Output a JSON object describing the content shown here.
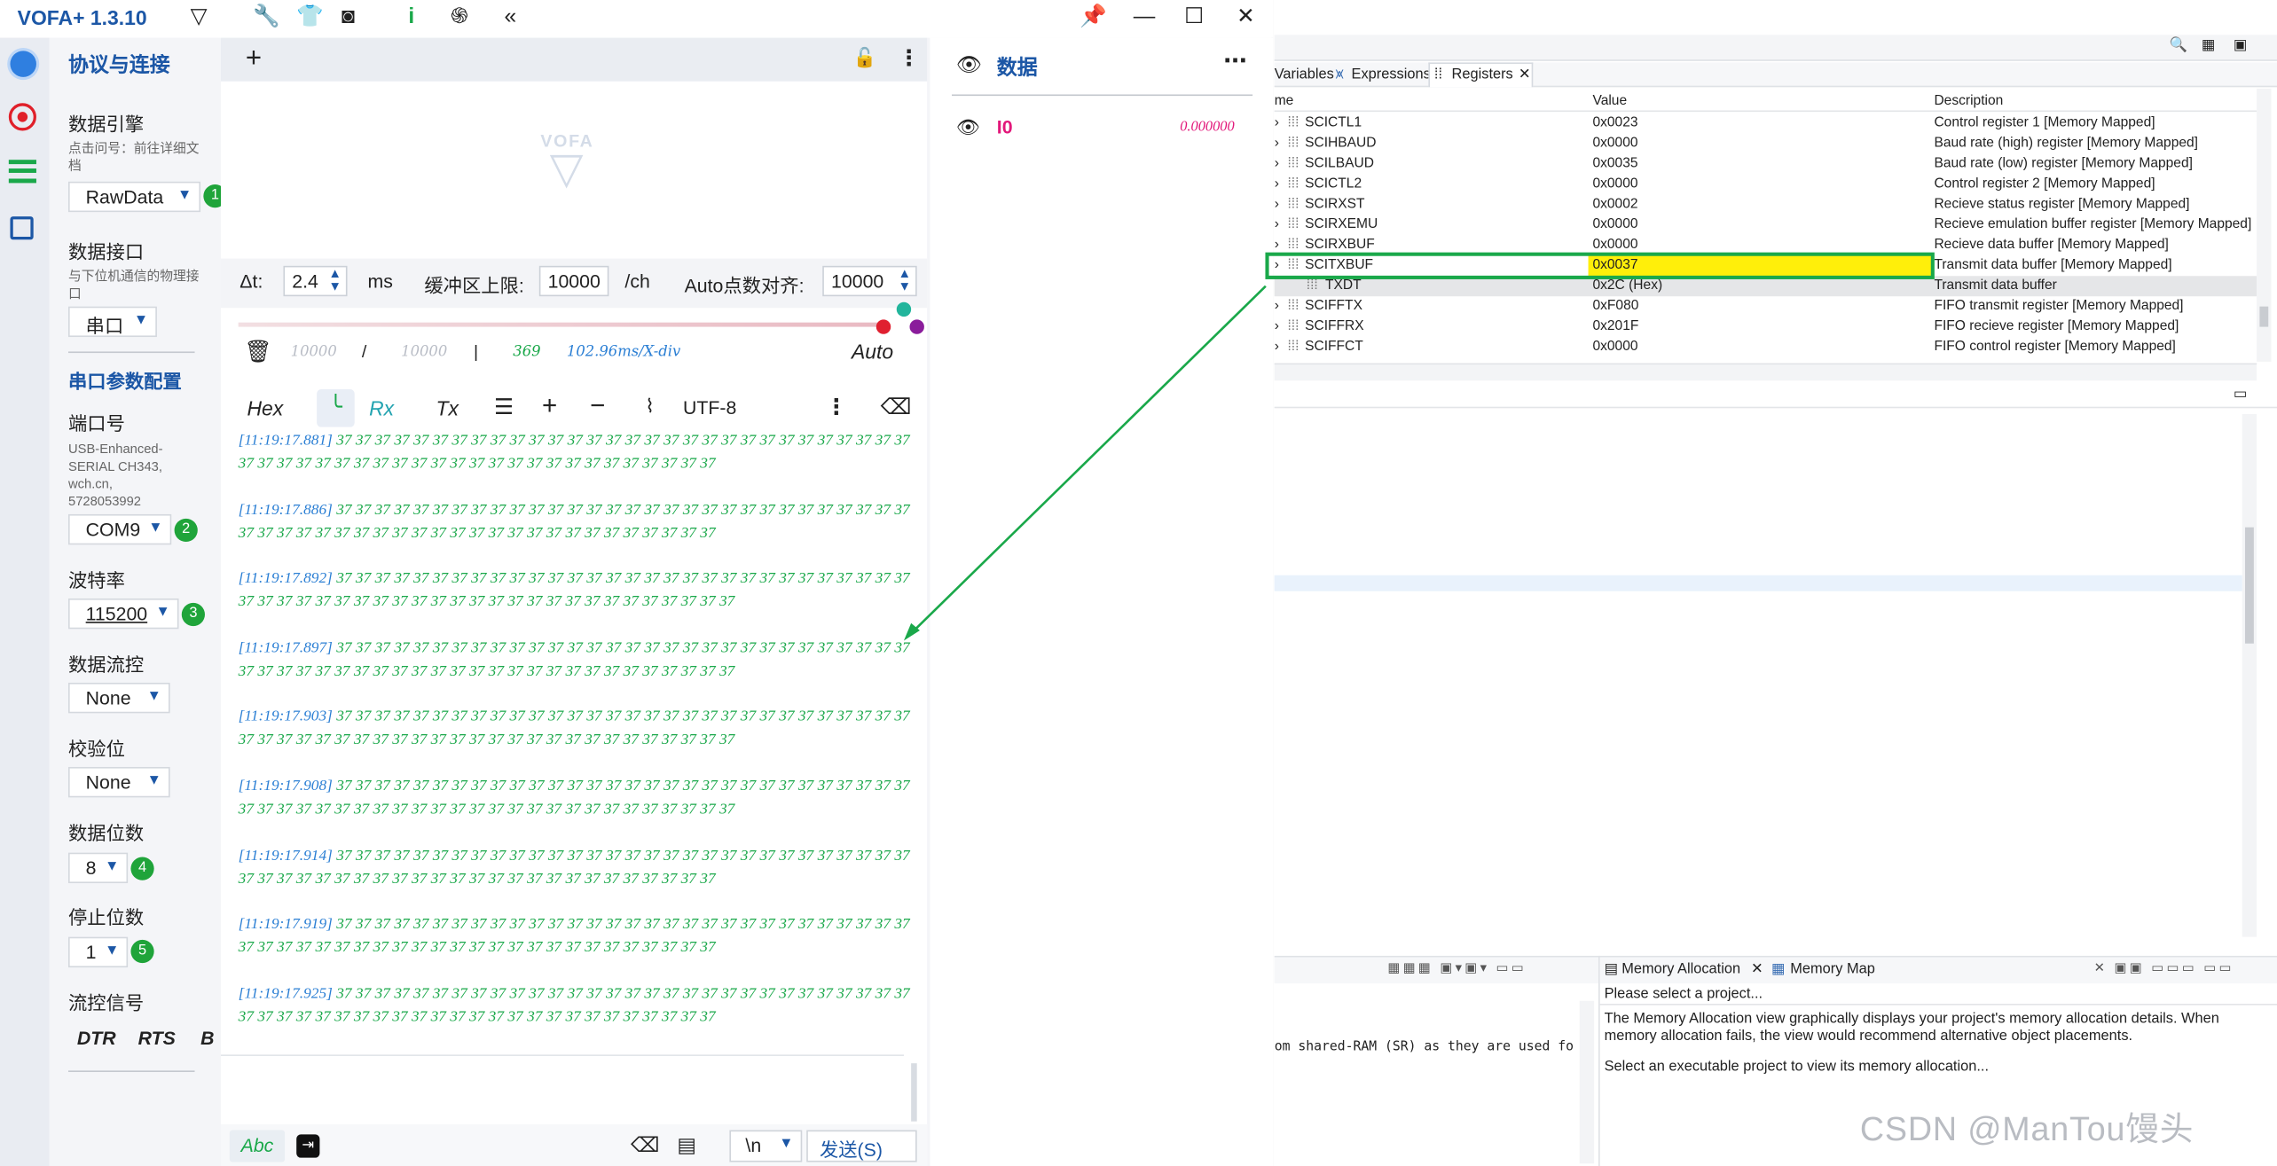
{
  "app": {
    "title": "VOFA+ 1.3.10"
  },
  "config": {
    "section_title": "协议与连接",
    "engine": {
      "label": "数据引擎",
      "hint": "点击问号：前往详细文档",
      "value": "RawData",
      "badge": "1"
    },
    "interface": {
      "label": "数据接口",
      "hint": "与下位机通信的物理接口",
      "value": "串口"
    },
    "serial_title": "串口参数配置",
    "port": {
      "label": "端口号",
      "hint": "USB-Enhanced-SERIAL CH343, wch.cn, 5728053992",
      "value": "COM9",
      "badge": "2"
    },
    "baud": {
      "label": "波特率",
      "value": "115200",
      "badge": "3"
    },
    "flow": {
      "label": "数据流控",
      "value": "None"
    },
    "parity": {
      "label": "校验位",
      "value": "None"
    },
    "databits": {
      "label": "数据位数",
      "value": "8",
      "badge": "4"
    },
    "stopbits": {
      "label": "停止位数",
      "value": "1",
      "badge": "5"
    },
    "signals": {
      "label": "流控信号",
      "dtr": "DTR",
      "rts": "RTS",
      "b": "B"
    }
  },
  "plot": {
    "watermark": "VOFA",
    "dt_label": "Δt:",
    "dt_value": "2.4",
    "dt_unit": "ms",
    "buffer_label": "缓冲区上限:",
    "buffer_value": "10000",
    "buffer_unit": "/ch",
    "auto_label": "Auto点数对齐:",
    "auto_value": "10000",
    "stat1": "10000",
    "slash": "/",
    "stat2": "10000",
    "bar": "|",
    "count": "369",
    "rate": "102.96ms/X-div",
    "auto": "Auto"
  },
  "log_toolbar": {
    "hex": "Hex",
    "rx": "Rx",
    "tx": "Tx",
    "encoding": "UTF-8"
  },
  "log": [
    {
      "ts": "[11:19:17.881]",
      "data": "37 37 37 37 37 37 37 37 37 37 37 37 37 37 37 37 37 37 37 37 37 37 37 37 37 37 37 37 37 37 37 37 37 37 37 37 37 37 37 37 37 37 37 37 37 37 37 37 37 37 37 37 37 37 37"
    },
    {
      "ts": "[11:19:17.886]",
      "data": "37 37 37 37 37 37 37 37 37 37 37 37 37 37 37 37 37 37 37 37 37 37 37 37 37 37 37 37 37 37 37 37 37 37 37 37 37 37 37 37 37 37 37 37 37 37 37 37 37 37 37 37 37 37 37"
    },
    {
      "ts": "[11:19:17.892]",
      "data": "37 37 37 37 37 37 37 37 37 37 37 37 37 37 37 37 37 37 37 37 37 37 37 37 37 37 37 37 37 37 37 37 37 37 37 37 37 37 37 37 37 37 37 37 37 37 37 37 37 37 37 37 37 37 37 37"
    },
    {
      "ts": "[11:19:17.897]",
      "data": "37 37 37 37 37 37 37 37 37 37 37 37 37 37 37 37 37 37 37 37 37 37 37 37 37 37 37 37 37 37 37 37 37 37 37 37 37 37 37 37 37 37 37 37 37 37 37 37 37 37 37 37 37 37 37 37"
    },
    {
      "ts": "[11:19:17.903]",
      "data": "37 37 37 37 37 37 37 37 37 37 37 37 37 37 37 37 37 37 37 37 37 37 37 37 37 37 37 37 37 37 37 37 37 37 37 37 37 37 37 37 37 37 37 37 37 37 37 37 37 37 37 37 37 37 37 37"
    },
    {
      "ts": "[11:19:17.908]",
      "data": "37 37 37 37 37 37 37 37 37 37 37 37 37 37 37 37 37 37 37 37 37 37 37 37 37 37 37 37 37 37 37 37 37 37 37 37 37 37 37 37 37 37 37 37 37 37 37 37 37 37 37 37 37 37 37 37"
    },
    {
      "ts": "[11:19:17.914]",
      "data": "37 37 37 37 37 37 37 37 37 37 37 37 37 37 37 37 37 37 37 37 37 37 37 37 37 37 37 37 37 37 37 37 37 37 37 37 37 37 37 37 37 37 37 37 37 37 37 37 37 37 37 37 37 37 37"
    },
    {
      "ts": "[11:19:17.919]",
      "data": "37 37 37 37 37 37 37 37 37 37 37 37 37 37 37 37 37 37 37 37 37 37 37 37 37 37 37 37 37 37 37 37 37 37 37 37 37 37 37 37 37 37 37 37 37 37 37 37 37 37 37 37 37 37 37"
    },
    {
      "ts": "[11:19:17.925]",
      "data": "37 37 37 37 37 37 37 37 37 37 37 37 37 37 37 37 37 37 37 37 37 37 37 37 37 37 37 37 37 37 37 37 37 37 37 37 37 37 37 37 37 37 37 37 37 37 37 37 37 37 37 37 37 37 37"
    }
  ],
  "send": {
    "abc": "Abc",
    "newline": "\\n",
    "send_label": "发送(S)"
  },
  "data_panel": {
    "title": "数据",
    "channel": "I0",
    "value": "0.000000"
  },
  "ccs": {
    "tabs": {
      "variables": "Variables",
      "expressions": "Expressions",
      "registers": "Registers"
    },
    "columns": {
      "name": "me",
      "value": "Value",
      "description": "Description"
    },
    "rows": [
      {
        "name": "SCICTL1",
        "value": "0x0023",
        "desc": "Control register 1 [Memory Mapped]"
      },
      {
        "name": "SCIHBAUD",
        "value": "0x0000",
        "desc": "Baud rate (high) register [Memory Mapped]"
      },
      {
        "name": "SCILBAUD",
        "value": "0x0035",
        "desc": "Baud rate (low) register [Memory Mapped]"
      },
      {
        "name": "SCICTL2",
        "value": "0x0000",
        "desc": "Control register 2 [Memory Mapped]"
      },
      {
        "name": "SCIRXST",
        "value": "0x0002",
        "desc": "Recieve status register [Memory Mapped]"
      },
      {
        "name": "SCIRXEMU",
        "value": "0x0000",
        "desc": "Recieve emulation buffer register [Memory Mapped]"
      },
      {
        "name": "SCIRXBUF",
        "value": "0x0000",
        "desc": "Recieve data buffer [Memory Mapped]"
      },
      {
        "name": "SCITXBUF",
        "value": "0x0037",
        "desc": "Transmit data buffer [Memory Mapped]"
      },
      {
        "name": "TXDT",
        "value": "0x2C (Hex)",
        "desc": "Transmit data buffer"
      },
      {
        "name": "SCIFFTX",
        "value": "0xF080",
        "desc": "FIFO transmit register [Memory Mapped]"
      },
      {
        "name": "SCIFFRX",
        "value": "0x201F",
        "desc": "FIFO recieve register [Memory Mapped]"
      },
      {
        "name": "SCIFFCT",
        "value": "0x0000",
        "desc": "FIFO control register [Memory Mapped]"
      }
    ],
    "console_text": "om shared-RAM (SR) as they are used fo",
    "mem_tab": "Memory Allocation",
    "map_tab": "Memory Map",
    "mem_select": "Please select a project...",
    "mem_desc": "The Memory Allocation view graphically displays your project's memory allocation details. When memory allocation fails, the view would recommend alternative object placements.",
    "mem_hint": "Select an executable project to view its memory allocation...",
    "watermark": "CSDN @ManTou馒头"
  }
}
